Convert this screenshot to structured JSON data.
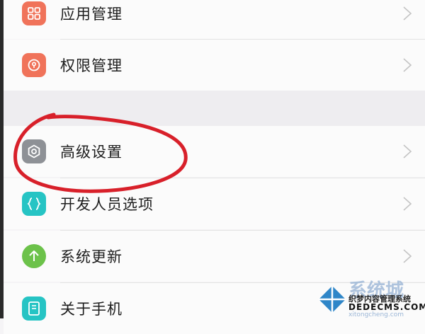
{
  "settings": {
    "items": [
      {
        "label": "应用管理",
        "icon": "app-grid-icon",
        "color": "#f0735a"
      },
      {
        "label": "权限管理",
        "icon": "shield-lock-icon",
        "color": "#f0735a"
      },
      {
        "label": "高级设置",
        "icon": "gear-icon",
        "color": "#8e9196"
      },
      {
        "label": "开发人员选项",
        "icon": "code-braces-icon",
        "color": "#26c4c4"
      },
      {
        "label": "系统更新",
        "icon": "arrow-up-icon",
        "color": "#6cc24a"
      },
      {
        "label": "关于手机",
        "icon": "phone-info-icon",
        "color": "#26c4c4"
      }
    ]
  },
  "annotation": {
    "color": "#d8202a"
  },
  "watermark": {
    "title": "系统城",
    "subtitle1": "织梦内容管理系统",
    "subtitle2": "DEDECMS.COM",
    "subtitle3": "xitongcheng.com"
  }
}
